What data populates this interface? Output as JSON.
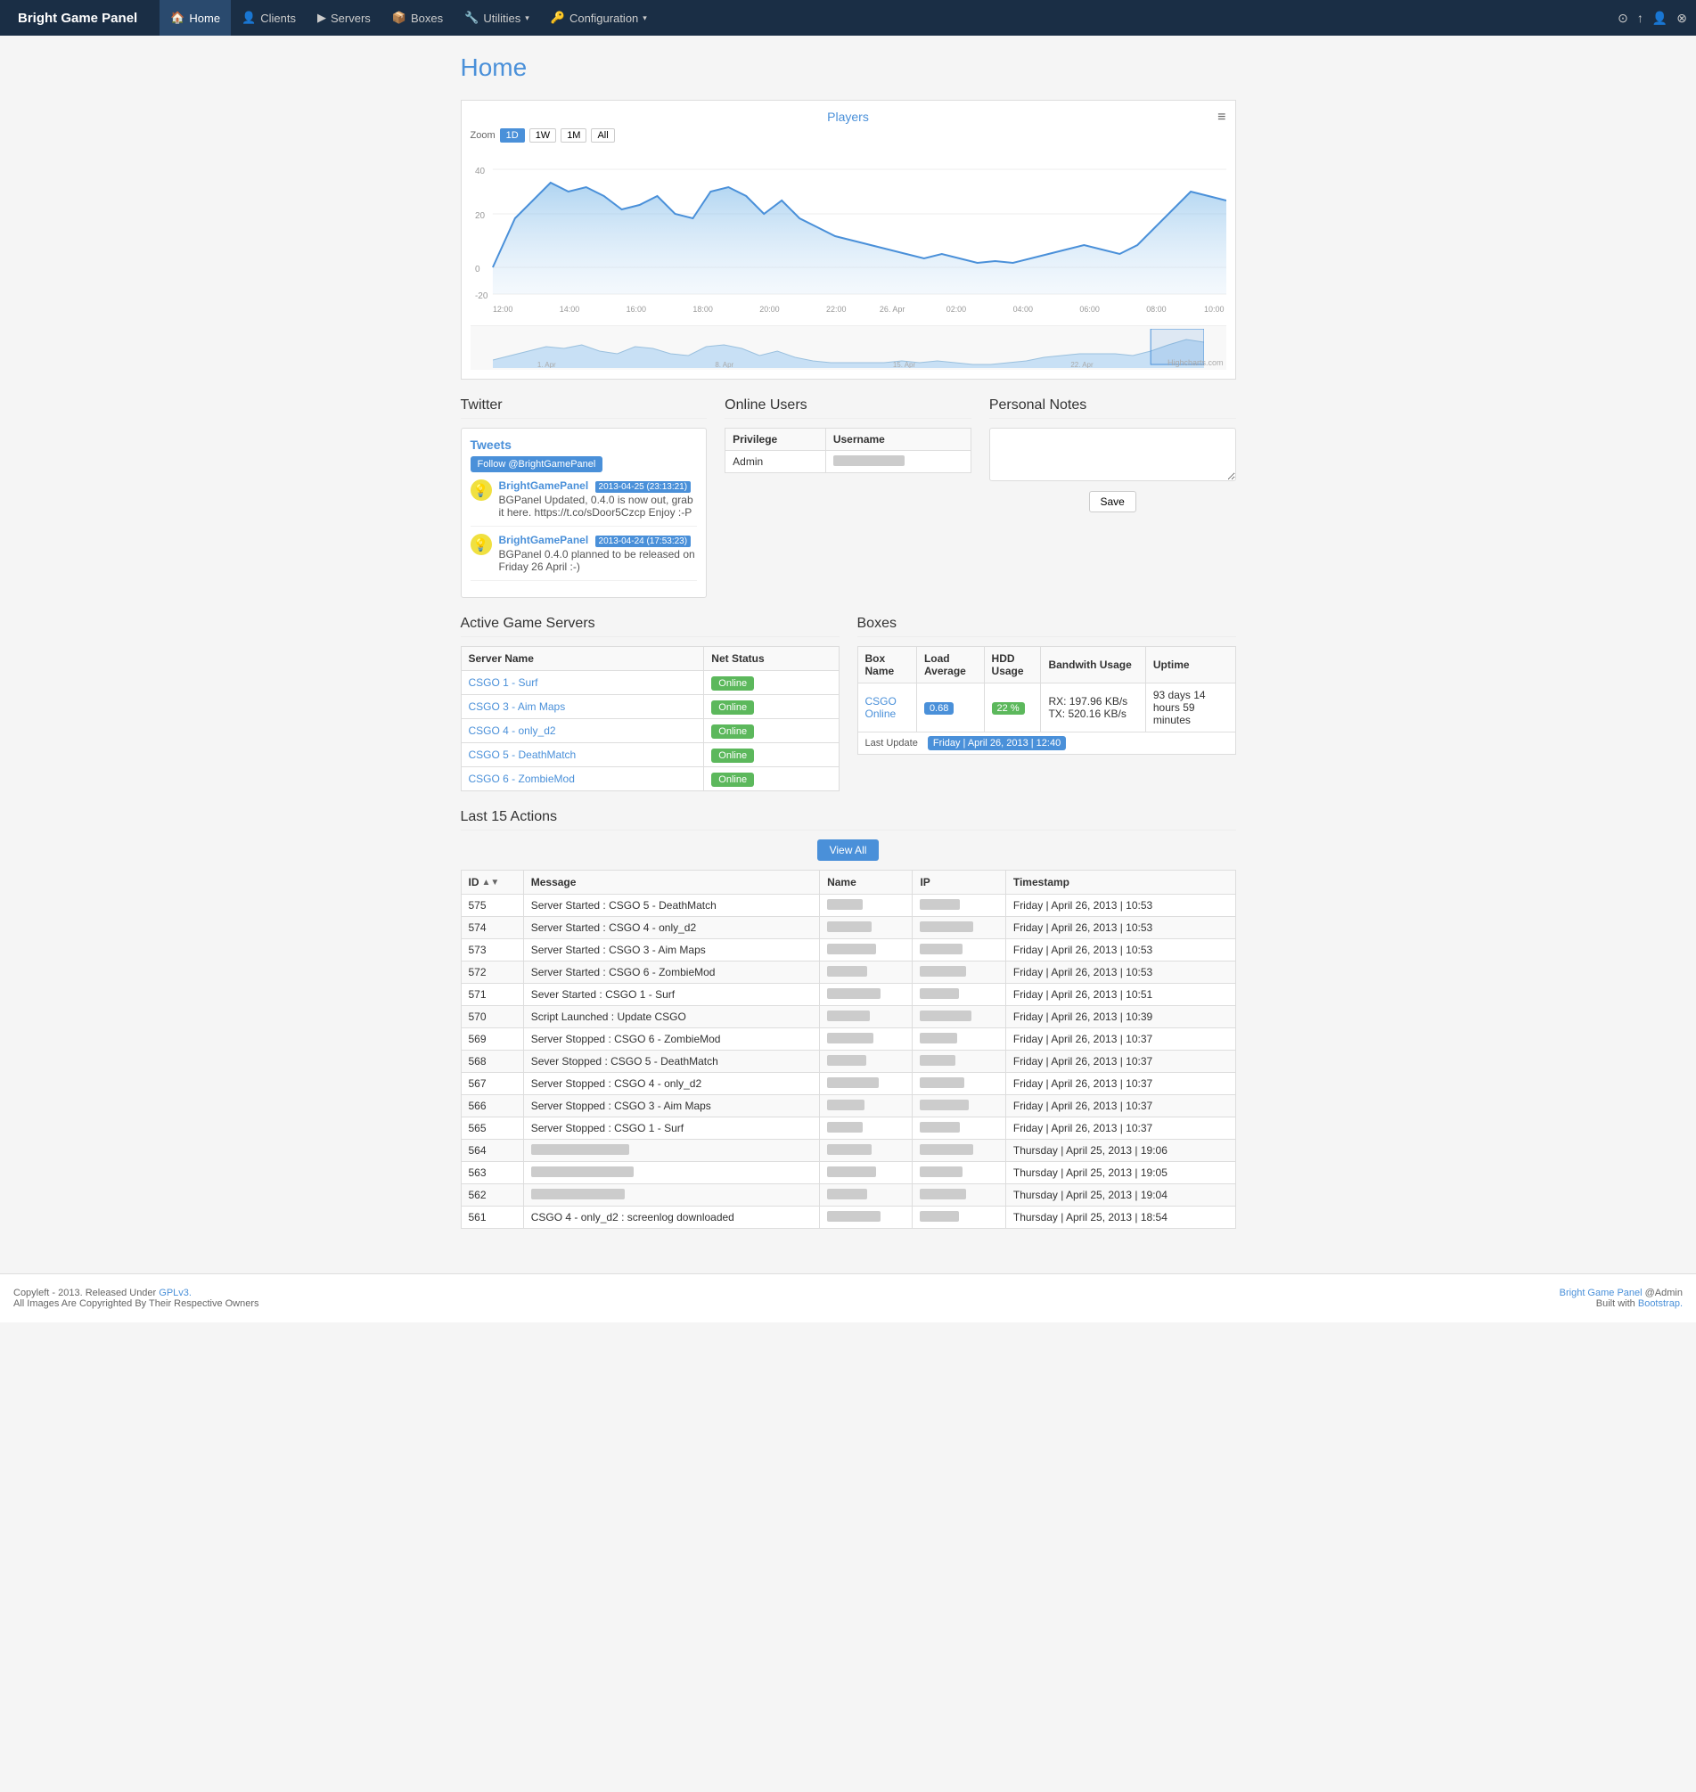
{
  "app": {
    "brand": "Bright Game Panel",
    "nav_items": [
      {
        "label": "Home",
        "icon": "🏠",
        "active": true
      },
      {
        "label": "Clients",
        "icon": "👤",
        "active": false
      },
      {
        "label": "Servers",
        "icon": "▶",
        "active": false
      },
      {
        "label": "Boxes",
        "icon": "📦",
        "active": false
      },
      {
        "label": "Utilities",
        "icon": "🔧",
        "active": false,
        "dropdown": true
      },
      {
        "label": "Configuration",
        "icon": "🔑",
        "active": false,
        "dropdown": true
      }
    ],
    "nav_right": [
      "⊙",
      "↑",
      "👤",
      "⊗"
    ]
  },
  "page": {
    "title": "Home"
  },
  "chart": {
    "title": "Players",
    "zoom_label": "Zoom",
    "zoom_options": [
      "1D",
      "1W",
      "1M",
      "All"
    ],
    "active_zoom": "1D"
  },
  "twitter": {
    "section_title": "Twitter",
    "tweets_label": "Tweets",
    "follow_label": "Follow @BrightGamePanel",
    "items": [
      {
        "handle": "BrightGamePanel",
        "date": "2013-04-25 (23:13:21)",
        "text": "BGPanel Updated, 0.4.0 is now out, grab it here. https://t.co/sDoor5Czcp Enjoy :-P"
      },
      {
        "handle": "BrightGamePanel",
        "date": "2013-04-24 (17:53:23)",
        "text": "BGPanel 0.4.0 planned to be released on Friday 26 April :-)"
      }
    ]
  },
  "online_users": {
    "section_title": "Online Users",
    "columns": [
      "Privilege",
      "Username"
    ],
    "rows": [
      {
        "privilege": "Admin",
        "username": ""
      }
    ]
  },
  "personal_notes": {
    "section_title": "Personal Notes",
    "placeholder": "",
    "save_label": "Save"
  },
  "active_servers": {
    "section_title": "Active Game Servers",
    "columns": [
      "Server Name",
      "Net Status"
    ],
    "rows": [
      {
        "name": "CSGO 1 - Surf",
        "status": "Online"
      },
      {
        "name": "CSGO 3 - Aim Maps",
        "status": "Online"
      },
      {
        "name": "CSGO 4 - only_d2",
        "status": "Online"
      },
      {
        "name": "CSGO 5 - DeathMatch",
        "status": "Online"
      },
      {
        "name": "CSGO 6 - ZombieMod",
        "status": "Online"
      }
    ]
  },
  "boxes": {
    "section_title": "Boxes",
    "columns": [
      "Box Name",
      "Load Average",
      "HDD Usage",
      "Bandwith Usage",
      "Uptime"
    ],
    "rows": [
      {
        "name": "CSGO Online",
        "load_avg": "0.68",
        "hdd_usage": "22 %",
        "bandwith": "RX: 197.96 KB/s   TX: 520.16 KB/s",
        "uptime": "93 days 14 hours 59 minutes"
      }
    ],
    "last_update_label": "Last Update",
    "last_update_value": "Friday | April 26, 2013 | 12:40"
  },
  "actions": {
    "section_title": "Last 15 Actions",
    "view_all_label": "View All",
    "columns": [
      "ID",
      "Message",
      "Name",
      "IP",
      "Timestamp"
    ],
    "rows": [
      {
        "id": "575",
        "message": "Server Started : CSGO 5 - DeathMatch",
        "name": "",
        "ip": "",
        "timestamp": "Friday | April 26, 2013 | 10:53"
      },
      {
        "id": "574",
        "message": "Server Started : CSGO 4 - only_d2",
        "name": "",
        "ip": "",
        "timestamp": "Friday | April 26, 2013 | 10:53"
      },
      {
        "id": "573",
        "message": "Server Started : CSGO 3 - Aim Maps",
        "name": "",
        "ip": "",
        "timestamp": "Friday | April 26, 2013 | 10:53"
      },
      {
        "id": "572",
        "message": "Server Started : CSGO 6 - ZombieMod",
        "name": "",
        "ip": "",
        "timestamp": "Friday | April 26, 2013 | 10:53"
      },
      {
        "id": "571",
        "message": "Sever Started : CSGO 1 - Surf",
        "name": "",
        "ip": "",
        "timestamp": "Friday | April 26, 2013 | 10:51"
      },
      {
        "id": "570",
        "message": "Script Launched : Update CSGO",
        "name": "",
        "ip": "",
        "timestamp": "Friday | April 26, 2013 | 10:39"
      },
      {
        "id": "569",
        "message": "Server Stopped : CSGO 6 - ZombieMod",
        "name": "",
        "ip": "",
        "timestamp": "Friday | April 26, 2013 | 10:37"
      },
      {
        "id": "568",
        "message": "Sever Stopped : CSGO 5 - DeathMatch",
        "name": "",
        "ip": "",
        "timestamp": "Friday | April 26, 2013 | 10:37"
      },
      {
        "id": "567",
        "message": "Server Stopped : CSGO 4 - only_d2",
        "name": "",
        "ip": "",
        "timestamp": "Friday | April 26, 2013 | 10:37"
      },
      {
        "id": "566",
        "message": "Server Stopped : CSGO 3 - Aim Maps",
        "name": "",
        "ip": "",
        "timestamp": "Friday | April 26, 2013 | 10:37"
      },
      {
        "id": "565",
        "message": "Server Stopped : CSGO 1 - Surf",
        "name": "",
        "ip": "",
        "timestamp": "Friday | April 26, 2013 | 10:37"
      },
      {
        "id": "564",
        "message": "",
        "name": "",
        "ip": "",
        "timestamp": "Thursday | April 25, 2013 | 19:06"
      },
      {
        "id": "563",
        "message": "",
        "name": "",
        "ip": "",
        "timestamp": "Thursday | April 25, 2013 | 19:05"
      },
      {
        "id": "562",
        "message": "",
        "name": "",
        "ip": "",
        "timestamp": "Thursday | April 25, 2013 | 19:04"
      },
      {
        "id": "561",
        "message": "CSGO 4 - only_d2 : screenlog downloaded",
        "name": "",
        "ip": "",
        "timestamp": "Thursday | April 25, 2013 | 18:54"
      }
    ]
  },
  "footer": {
    "left_line1": "Copyleft - 2013. Released Under ",
    "gpl_label": "GPLv3.",
    "left_line2": "All Images Are Copyrighted By Their Respective Owners",
    "right_line1_pre": "Bright Game Panel",
    "right_line1_post": " @Admin",
    "right_line2_pre": "Built with ",
    "right_line2_bootstrap": "Bootstrap."
  }
}
